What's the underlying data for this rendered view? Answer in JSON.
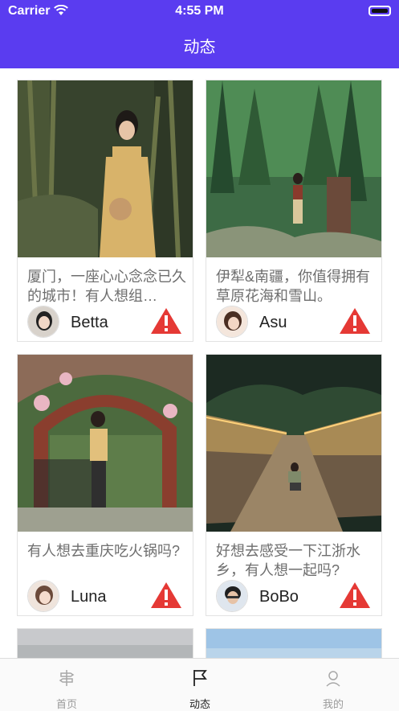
{
  "status_bar": {
    "carrier": "Carrier",
    "time": "4:55 PM"
  },
  "header": {
    "title": "动态"
  },
  "feed": {
    "cards": [
      {
        "caption": "厦门，一座心心念念已久的城市！有人想组…",
        "username": "Betta"
      },
      {
        "caption": "伊犁&南疆，你值得拥有草原花海和雪山。",
        "username": "Asu"
      },
      {
        "caption": " 有人想去重庆吃火锅吗?",
        "username": "Luna"
      },
      {
        "caption": "好想去感受一下江浙水乡，有人想一起吗?",
        "username": "BoBo"
      }
    ]
  },
  "tabbar": {
    "tabs": [
      {
        "label": "首页",
        "icon": "signpost-icon"
      },
      {
        "label": "动态",
        "icon": "flag-icon"
      },
      {
        "label": "我的",
        "icon": "person-icon"
      }
    ],
    "active_tab": "动态"
  },
  "colors": {
    "accent": "#5a3cf0",
    "report": "#e53935"
  }
}
